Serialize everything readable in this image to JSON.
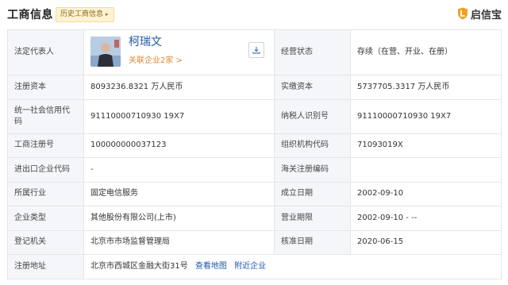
{
  "header": {
    "title": "工商信息",
    "history_tag": "历史工商信息",
    "brand": "启信宝"
  },
  "rows": {
    "legal_rep": {
      "label": "法定代表人",
      "name": "柯瑞文",
      "related": "关联企业2家 >"
    },
    "status": {
      "label": "经营状态",
      "value": "存续（在营、开业、在册）"
    },
    "reg_capital": {
      "label": "注册资本",
      "value": "8093236.8321 万人民币"
    },
    "paid_capital": {
      "label": "实缴资本",
      "value": "5737705.3317 万人民币"
    },
    "uscc": {
      "label": "统一社会信用代码",
      "value": "91110000710930 19X7"
    },
    "taxpayer_id": {
      "label": "纳税人识别号",
      "value": "91110000710930 19X7"
    },
    "biz_reg_no": {
      "label": "工商注册号",
      "value": "100000000037123"
    },
    "org_code": {
      "label": "组织机构代码",
      "value": "71093019X"
    },
    "import_export": {
      "label": "进出口企业代码",
      "value": "-"
    },
    "customs": {
      "label": "海关注册编码",
      "value": ""
    },
    "industry": {
      "label": "所属行业",
      "value": "固定电信服务"
    },
    "founded": {
      "label": "成立日期",
      "value": "2002-09-10"
    },
    "company_type": {
      "label": "企业类型",
      "value": "其他股份有限公司(上市)"
    },
    "term": {
      "label": "营业期限",
      "value": "2002-09-10 - --"
    },
    "authority": {
      "label": "登记机关",
      "value": "北京市市场监督管理局"
    },
    "approved": {
      "label": "核准日期",
      "value": "2020-06-15"
    },
    "address": {
      "label": "注册地址",
      "value": "北京市西城区金融大街31号",
      "map_link": "查看地图",
      "nearby_link": "附近企业"
    }
  },
  "colors": {
    "label_bg": "#f4f6fa",
    "link_blue": "#1f5aa8",
    "accent_orange": "#e0883a",
    "tag_bg": "#fdf2d2",
    "brand_orange": "#f0a020"
  }
}
